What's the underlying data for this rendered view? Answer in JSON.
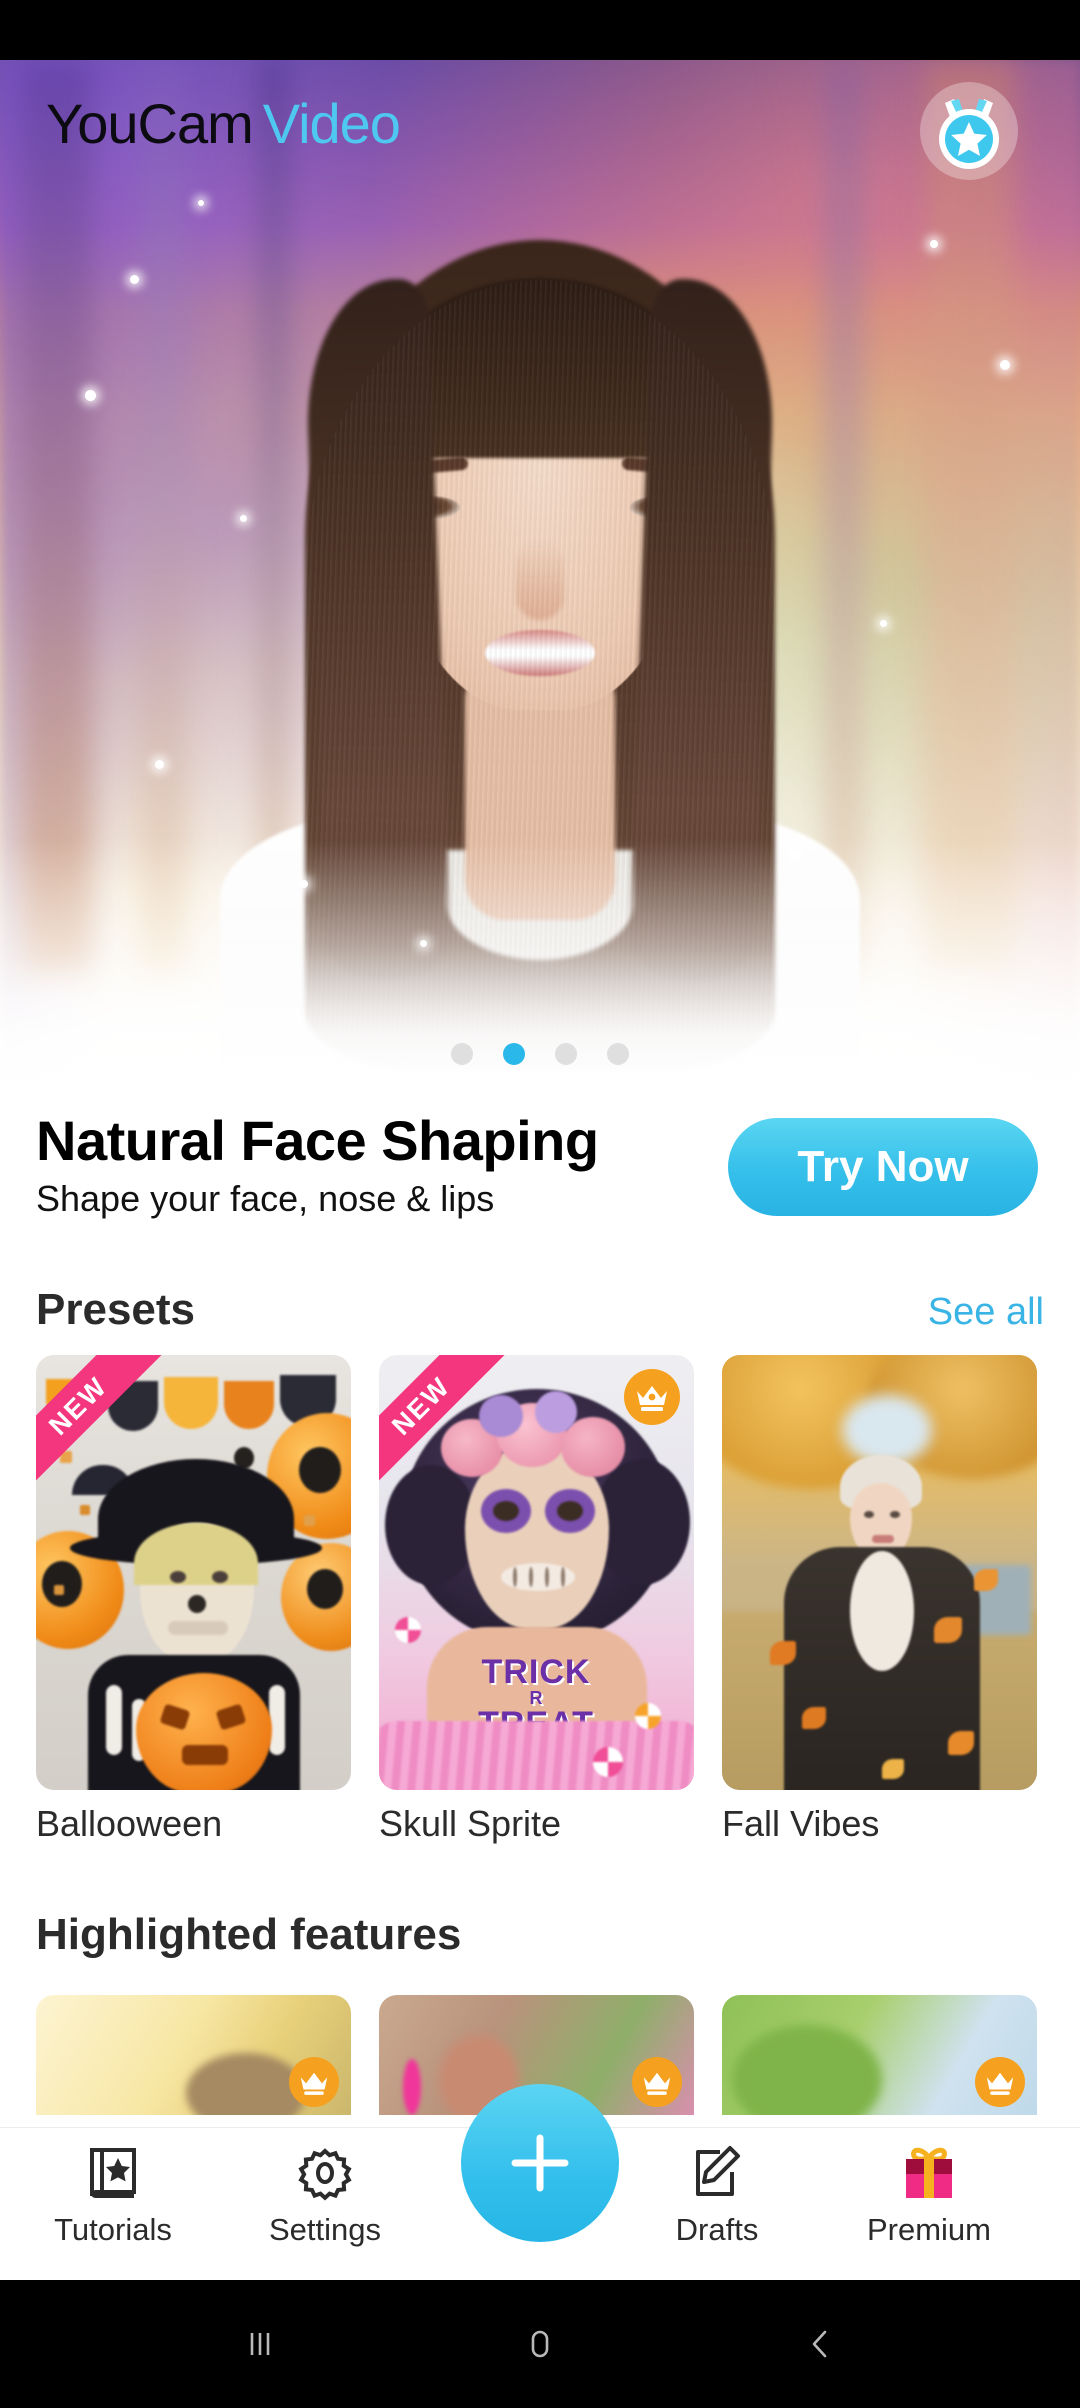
{
  "app": {
    "logo_primary": "YouCam",
    "logo_secondary": "Video",
    "award_icon": "medal-star-icon"
  },
  "hero": {
    "carousel": {
      "total_dots": 4,
      "active_index": 1
    },
    "promo": {
      "title": "Natural Face Shaping",
      "subtitle": "Shape your face, nose & lips",
      "cta_label": "Try Now"
    }
  },
  "presets": {
    "section_title": "Presets",
    "see_all_label": "See all",
    "items": [
      {
        "label": "Ballooween",
        "badge": "NEW",
        "premium": false
      },
      {
        "label": "Skull Sprite",
        "badge": "NEW",
        "premium": true
      },
      {
        "label": "Fall Vibes",
        "badge": "",
        "premium": false
      }
    ]
  },
  "highlighted": {
    "section_title": "Highlighted features",
    "items": [
      {
        "premium": true
      },
      {
        "premium": true
      },
      {
        "premium": true
      }
    ]
  },
  "bottom_nav": {
    "items": [
      {
        "label": "Tutorials",
        "icon": "book-star-icon"
      },
      {
        "label": "Settings",
        "icon": "gear-icon"
      },
      {
        "label": "Drafts",
        "icon": "pen-edit-icon"
      },
      {
        "label": "Premium",
        "icon": "gift-box-icon"
      }
    ],
    "fab_icon": "plus-icon"
  },
  "system_nav": {
    "recents_icon": "recents-icon",
    "home_icon": "home-icon",
    "back_icon": "back-icon"
  },
  "colors": {
    "accent": "#2ab8ea",
    "link": "#3ab4e4",
    "new_badge": "#f4367e",
    "premium_badge": "#f5a01e"
  }
}
